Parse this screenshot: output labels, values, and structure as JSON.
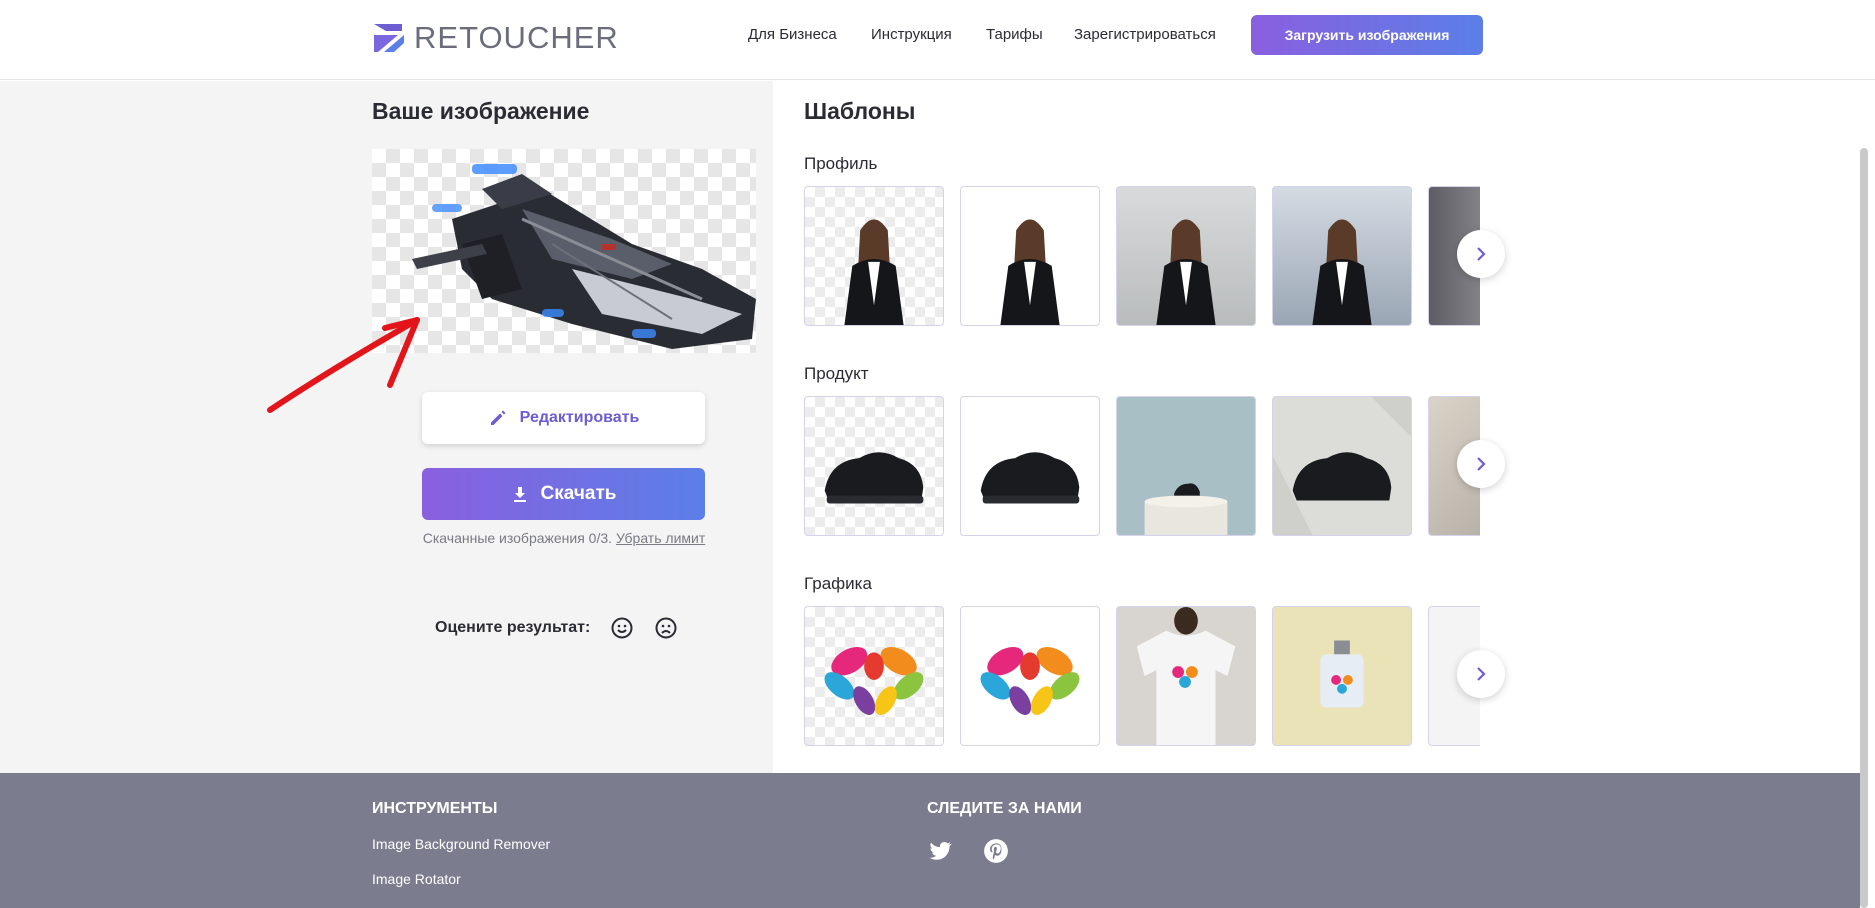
{
  "header": {
    "logo_text": "RETOUCHER",
    "nav": [
      "Для Бизнеса",
      "Инструкция",
      "Тарифы",
      "Зарегистрироваться"
    ],
    "upload_label": "Загрузить изображения"
  },
  "left": {
    "title": "Ваше изображение",
    "edit_label": "Редактировать",
    "download_label": "Скачать",
    "download_note": "Скачанные изображения 0/3.",
    "remove_limit": "Убрать лимит",
    "rate_label": "Оцените результат:"
  },
  "right": {
    "title": "Шаблоны",
    "categories": [
      {
        "label": "Профиль"
      },
      {
        "label": "Продукт"
      },
      {
        "label": "Графика"
      }
    ]
  },
  "footer": {
    "tools_title": "ИНСТРУМЕНТЫ",
    "tools": [
      "Image Background Remover",
      "Image Rotator"
    ],
    "follow_title": "СЛЕДИТЕ ЗА НАМИ",
    "social_icons": [
      "twitter-icon",
      "pinterest-icon"
    ]
  },
  "colors": {
    "accent_start": "#8a5fe0",
    "accent_end": "#5b7fe6",
    "footer_bg": "#7b7d8f",
    "left_panel_bg": "#f4f4f4"
  }
}
